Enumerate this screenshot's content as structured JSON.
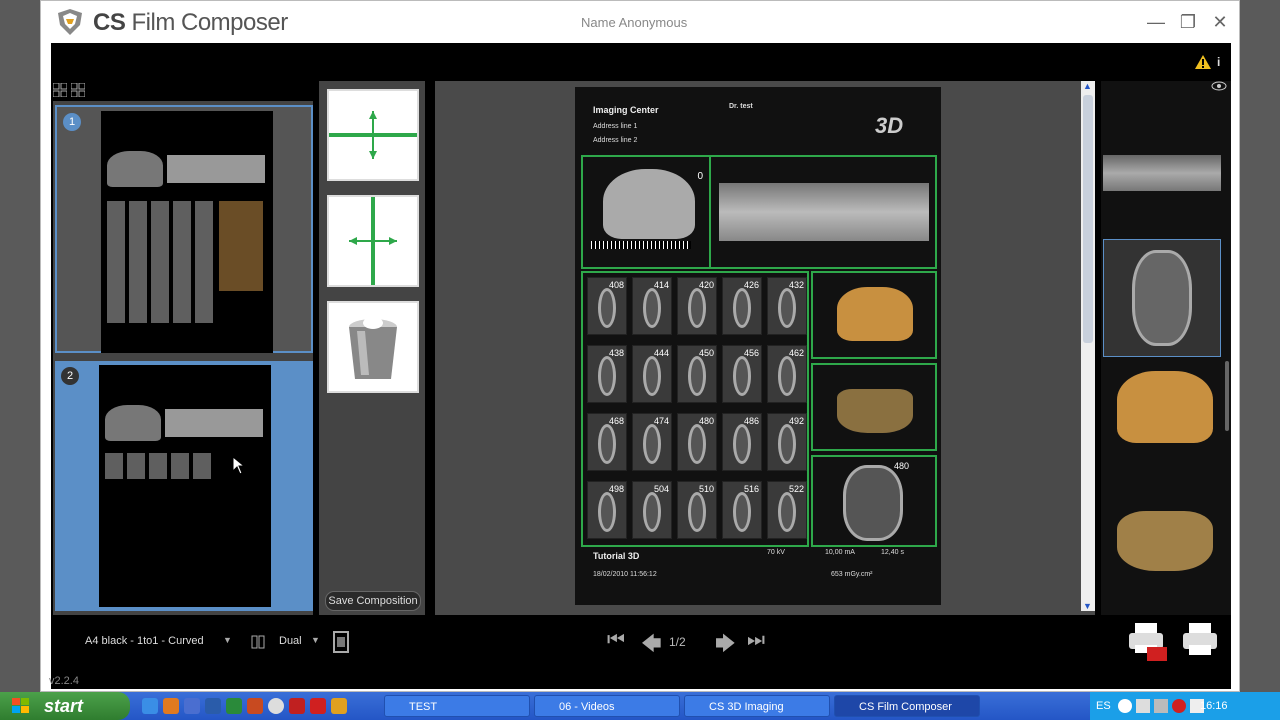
{
  "window": {
    "app_title_prefix": "CS",
    "app_title_rest": "Film Composer",
    "user_name": "Name Anonymous",
    "version": "v2.2.4"
  },
  "thumbnails": [
    {
      "number": "1",
      "selected": false
    },
    {
      "number": "2",
      "selected": true
    }
  ],
  "tools": {
    "save_label": "Save Composition"
  },
  "page": {
    "header": {
      "center": "Imaging Center",
      "address1": "Address line 1",
      "address2": "Address line 2",
      "doctor": "Dr. test",
      "logo_text": "3D"
    },
    "panoramic_zero": "0",
    "slice_numbers": [
      [
        "408",
        "414",
        "420",
        "426",
        "432"
      ],
      [
        "438",
        "444",
        "450",
        "456",
        "462"
      ],
      [
        "468",
        "474",
        "480",
        "486",
        "492"
      ],
      [
        "498",
        "504",
        "510",
        "516",
        "522"
      ]
    ],
    "detail_number": "480",
    "footer": {
      "title": "Tutorial 3D",
      "date": "18/02/2010 11:56:12",
      "kv": "70 kV",
      "ma": "10,00 mA",
      "time": "12,40 s",
      "dose": "653 mGy.cm²"
    }
  },
  "bottom": {
    "layout_select": "A4 black - 1to1 - Curved",
    "view_mode": "Dual",
    "page_indicator": "1/2"
  },
  "taskbar": {
    "start_label": "start",
    "items": [
      {
        "label": "TEST"
      },
      {
        "label": "06 - Videos"
      },
      {
        "label": "CS 3D Imaging"
      },
      {
        "label": "CS Film Composer"
      }
    ],
    "lang": "ES",
    "clock": "16:16"
  },
  "colors": {
    "accent_green": "#2ea84a",
    "selection_blue": "#5b8fc7",
    "taskbar_blue": "#2456c6"
  }
}
